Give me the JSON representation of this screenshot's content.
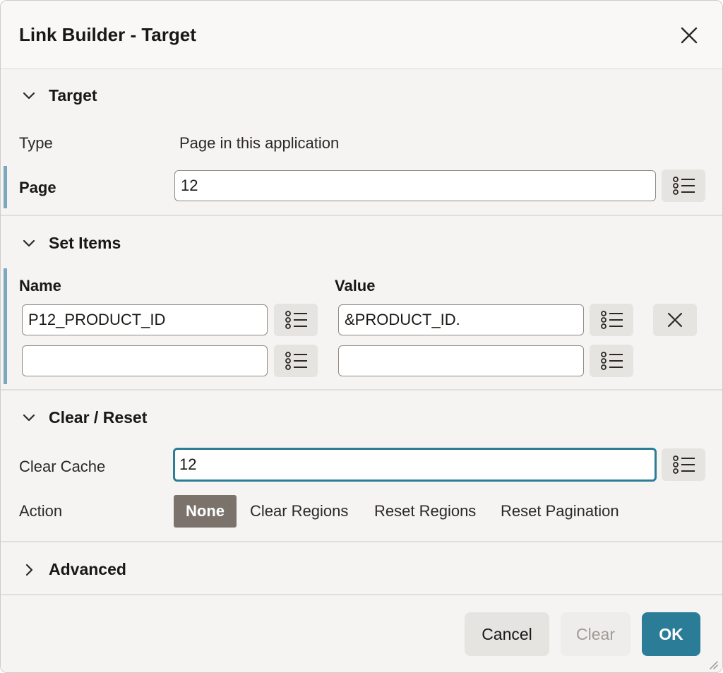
{
  "dialog": {
    "title": "Link Builder - Target"
  },
  "target": {
    "heading": "Target",
    "type_label": "Type",
    "type_value": "Page in this application",
    "page_label": "Page",
    "page_value": "12"
  },
  "set_items": {
    "heading": "Set Items",
    "name_header": "Name",
    "value_header": "Value",
    "rows": [
      {
        "name": "P12_PRODUCT_ID",
        "value": "&PRODUCT_ID."
      },
      {
        "name": "",
        "value": ""
      }
    ]
  },
  "clear_reset": {
    "heading": "Clear / Reset",
    "clear_cache_label": "Clear Cache",
    "clear_cache_value": "12",
    "action_label": "Action",
    "actions": [
      "None",
      "Clear Regions",
      "Reset Regions",
      "Reset Pagination"
    ],
    "selected_action": "None"
  },
  "advanced": {
    "heading": "Advanced"
  },
  "footer": {
    "cancel": "Cancel",
    "clear": "Clear",
    "ok": "OK"
  },
  "colors": {
    "primary": "#2b7d97",
    "focus_border": "#2c7d96",
    "required_marker": "#7da7bf",
    "selected_radio": "#7a726b"
  }
}
